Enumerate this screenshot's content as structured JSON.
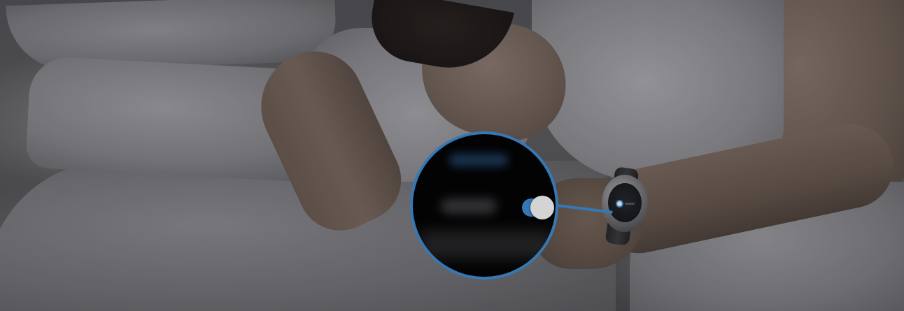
{
  "photo": {
    "subject": "sleeping-man-wearing-smartwatch",
    "icons": [
      "smartwatch-icon",
      "toggle-switch-icon"
    ]
  },
  "callout": {
    "accent_color": "#3f8fd6",
    "toggle_state": "on",
    "toggle_knob_color": "#ffffff"
  }
}
